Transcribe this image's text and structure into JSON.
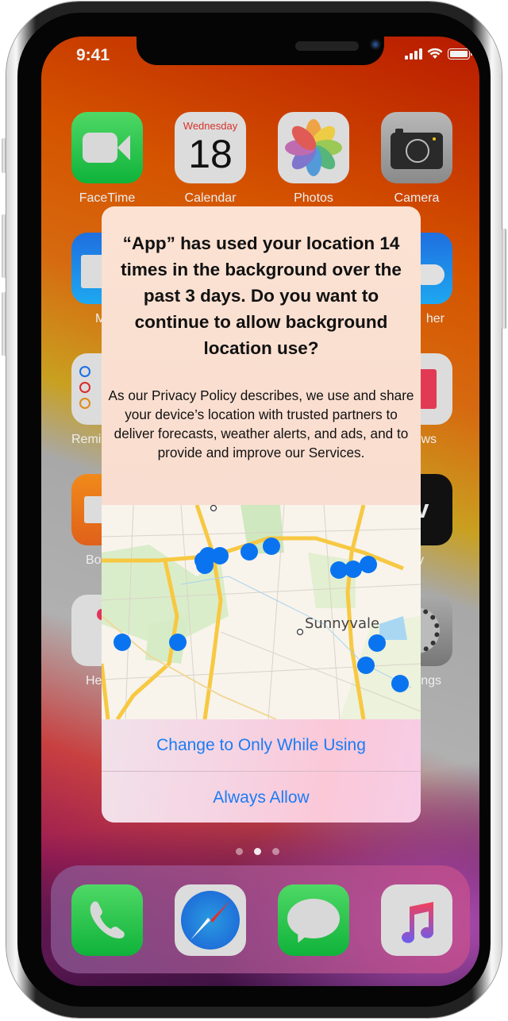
{
  "status_bar": {
    "time": "9:41",
    "icons": [
      "cellular-signal-icon",
      "wifi-icon",
      "battery-icon"
    ]
  },
  "home_screen": {
    "rows": [
      [
        {
          "name": "FaceTime",
          "icon": "facetime-icon"
        },
        {
          "name": "Calendar",
          "icon": "calendar-icon",
          "day_name": "Wednesday",
          "day_number": "18"
        },
        {
          "name": "Photos",
          "icon": "photos-icon"
        },
        {
          "name": "Camera",
          "icon": "camera-icon"
        }
      ],
      [
        {
          "name": "Mail",
          "icon": "mail-icon",
          "visible_label": "M"
        },
        {
          "name": "Weather",
          "icon": "weather-icon",
          "visible_label": "her"
        }
      ],
      [
        {
          "name": "Reminders",
          "icon": "reminders-icon",
          "visible_label": "Remi"
        },
        {
          "name": "News",
          "icon": "news-icon",
          "visible_label": "ws"
        }
      ],
      [
        {
          "name": "Books",
          "icon": "books-icon",
          "visible_label": "Bo"
        },
        {
          "name": "TV",
          "icon": "tv-icon",
          "visible_label": "y",
          "glyph": "tv"
        }
      ],
      [
        {
          "name": "Health",
          "icon": "health-icon",
          "visible_label": "He"
        },
        {
          "name": "Settings",
          "icon": "settings-icon",
          "visible_label": "ngs"
        }
      ]
    ],
    "page_indicator": {
      "count": 3,
      "active_index": 1
    },
    "dock": [
      {
        "name": "Phone",
        "icon": "phone-icon"
      },
      {
        "name": "Safari",
        "icon": "safari-icon"
      },
      {
        "name": "Messages",
        "icon": "messages-icon"
      },
      {
        "name": "Music",
        "icon": "music-icon"
      }
    ]
  },
  "alert": {
    "title": "“App” has used your location 14 times in the background over the past 3 days. Do you want to continue to allow background location use?",
    "body": "As our Privacy Policy describes, we use and share your device’s location with trusted partners to deliver forecasts, weather alerts, and ads, and to provide and improve our Services.",
    "map": {
      "city_label": "Sunnyvale",
      "location_point_count": 14,
      "pin_color": "#0a74f0"
    },
    "buttons": [
      {
        "label": "Change to Only While Using"
      },
      {
        "label": "Always Allow"
      }
    ]
  },
  "colors": {
    "accent": "#1a7cf5",
    "map_road": "#f7c842",
    "map_park": "#d6ecc6"
  }
}
